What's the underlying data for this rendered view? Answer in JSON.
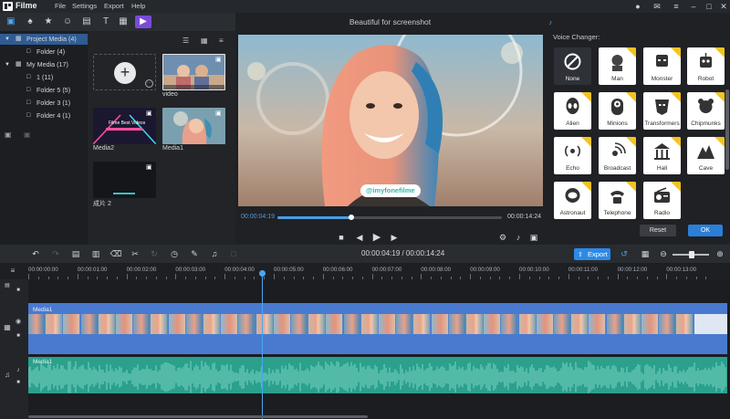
{
  "app": {
    "name": "Filme"
  },
  "menu": [
    "File",
    "Settings",
    "Export",
    "Help"
  ],
  "library": {
    "tree": [
      {
        "label": "Project Media (4)",
        "selected": true
      },
      {
        "label": "Folder (4)"
      },
      {
        "label": "My Media (17)"
      },
      {
        "label": "1 (11)"
      },
      {
        "label": "Folder 5 (5)"
      },
      {
        "label": "Folder 3 (1)"
      },
      {
        "label": "Folder 4 (1)"
      }
    ],
    "media": [
      {
        "label": "video"
      },
      {
        "label": "Media2"
      },
      {
        "label": "Media1"
      },
      {
        "label": "成片 2"
      }
    ],
    "thumb_title": "Filme Best Videos"
  },
  "preview": {
    "title": "Beautiful for screenshot",
    "watermark": "@imyfonefilme",
    "current_time": "00:00:04:19",
    "total_time": "00:00:14:24",
    "progress": 0.33
  },
  "voice_changer": {
    "title": "Voice Changer:",
    "effects": [
      {
        "label": "None",
        "icon": "none-icon",
        "selected": true
      },
      {
        "label": "Man",
        "icon": "man-icon"
      },
      {
        "label": "Monster",
        "icon": "monster-icon"
      },
      {
        "label": "Robot",
        "icon": "robot-icon"
      },
      {
        "label": "Alien",
        "icon": "alien-icon"
      },
      {
        "label": "Minions",
        "icon": "minions-icon"
      },
      {
        "label": "Transformers",
        "icon": "transformers-icon"
      },
      {
        "label": "Chipmunks",
        "icon": "chipmunks-icon"
      },
      {
        "label": "Echo",
        "icon": "echo-icon"
      },
      {
        "label": "Broadcast",
        "icon": "broadcast-icon"
      },
      {
        "label": "Hall",
        "icon": "hall-icon"
      },
      {
        "label": "Cave",
        "icon": "cave-icon"
      },
      {
        "label": "Astronaut",
        "icon": "astronaut-icon"
      },
      {
        "label": "Telephone",
        "icon": "telephone-icon"
      },
      {
        "label": "Radio",
        "icon": "radio-icon"
      }
    ],
    "reset_label": "Reset",
    "ok_label": "OK"
  },
  "timeline": {
    "time_display": "00:00:04:19 / 00:00:14:24",
    "export_label": "Export",
    "ruler": [
      "00:00:00:00",
      "00:00:01:00",
      "00:00:02:00",
      "00:00:03:00",
      "00:00:04:00",
      "00:00:05:00",
      "00:00:06:00",
      "00:00:07:00",
      "00:00:08:00",
      "00:00:09:00",
      "00:00:10:00",
      "00:00:11:00",
      "00:00:12:00",
      "00:00:13:00"
    ],
    "video_clip_label": "Media1",
    "audio_clip_label": "Media1"
  },
  "colors": {
    "accent": "#2b8ae6",
    "video_track": "#4a7ad0",
    "audio_track": "#2aa08d",
    "vip_badge": "#f3c321"
  }
}
